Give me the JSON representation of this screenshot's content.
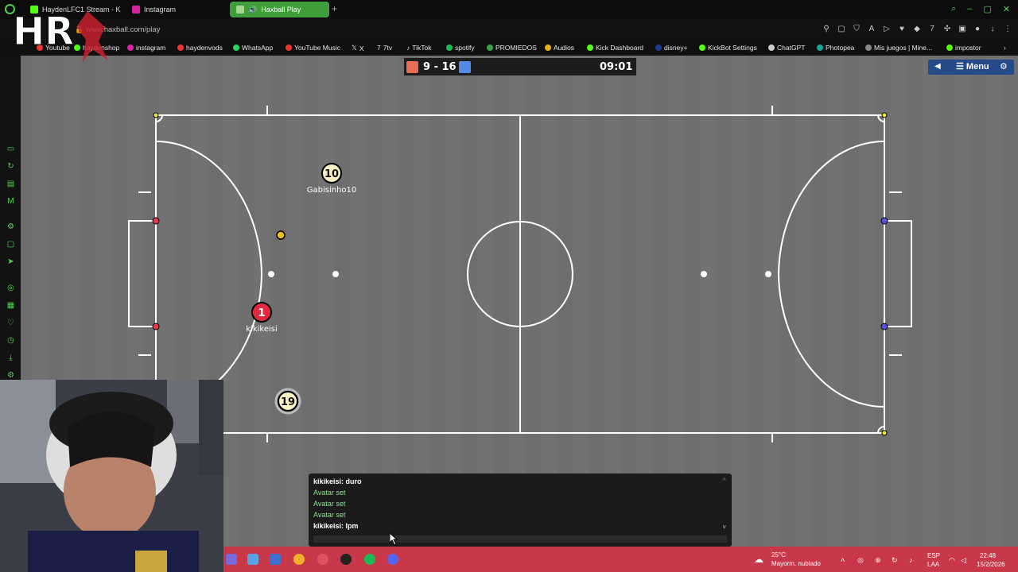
{
  "browser": {
    "tabs": [
      {
        "label": "HaydenLFC1 Stream - K"
      },
      {
        "label": "Instagram"
      },
      {
        "label": "Haxball Play"
      }
    ],
    "url": "www.haxball.com/play"
  },
  "bookmarks": [
    {
      "label": "Youtube"
    },
    {
      "label": "haydenshop"
    },
    {
      "label": "instagram"
    },
    {
      "label": "haydenvods"
    },
    {
      "label": "WhatsApp"
    },
    {
      "label": "YouTube Music"
    },
    {
      "label": "X"
    },
    {
      "label": "7tv"
    },
    {
      "label": "TikTok"
    },
    {
      "label": "spotify"
    },
    {
      "label": "PROMIEDOS"
    },
    {
      "label": "Audios"
    },
    {
      "label": "Kick Dashboard"
    },
    {
      "label": "disney+"
    },
    {
      "label": "KickBot Settings"
    },
    {
      "label": "ChatGPT"
    },
    {
      "label": "Photopea"
    },
    {
      "label": "Mis juegos | Mine..."
    },
    {
      "label": "impostor"
    }
  ],
  "game": {
    "score": "9 - 16",
    "timer": "09:01",
    "menu_label": "Menu",
    "red_color": "#e56e56",
    "blue_color": "#5689e5",
    "players": [
      {
        "number": "10",
        "name": "Gabisinho10",
        "team": "spectator-yellow"
      },
      {
        "number": "1",
        "name": "kikikeisi",
        "team": "red"
      },
      {
        "number": "19",
        "name": "",
        "team": "spectator-yellow"
      }
    ]
  },
  "chat": {
    "lines": [
      {
        "text": "kikikeisi: duro",
        "kind": "user"
      },
      {
        "text": "Avatar set",
        "kind": "sys"
      },
      {
        "text": "Avatar set",
        "kind": "sys"
      },
      {
        "text": "Avatar set",
        "kind": "sys"
      },
      {
        "text": "kikikeisi: lpm",
        "kind": "user"
      }
    ]
  },
  "taskbar": {
    "weather_temp": "25°C",
    "weather_desc": "Mayorm. nublado",
    "lang": "ESP",
    "lang_region": "LAA",
    "time": "22:48",
    "date": "15/2/2026"
  }
}
